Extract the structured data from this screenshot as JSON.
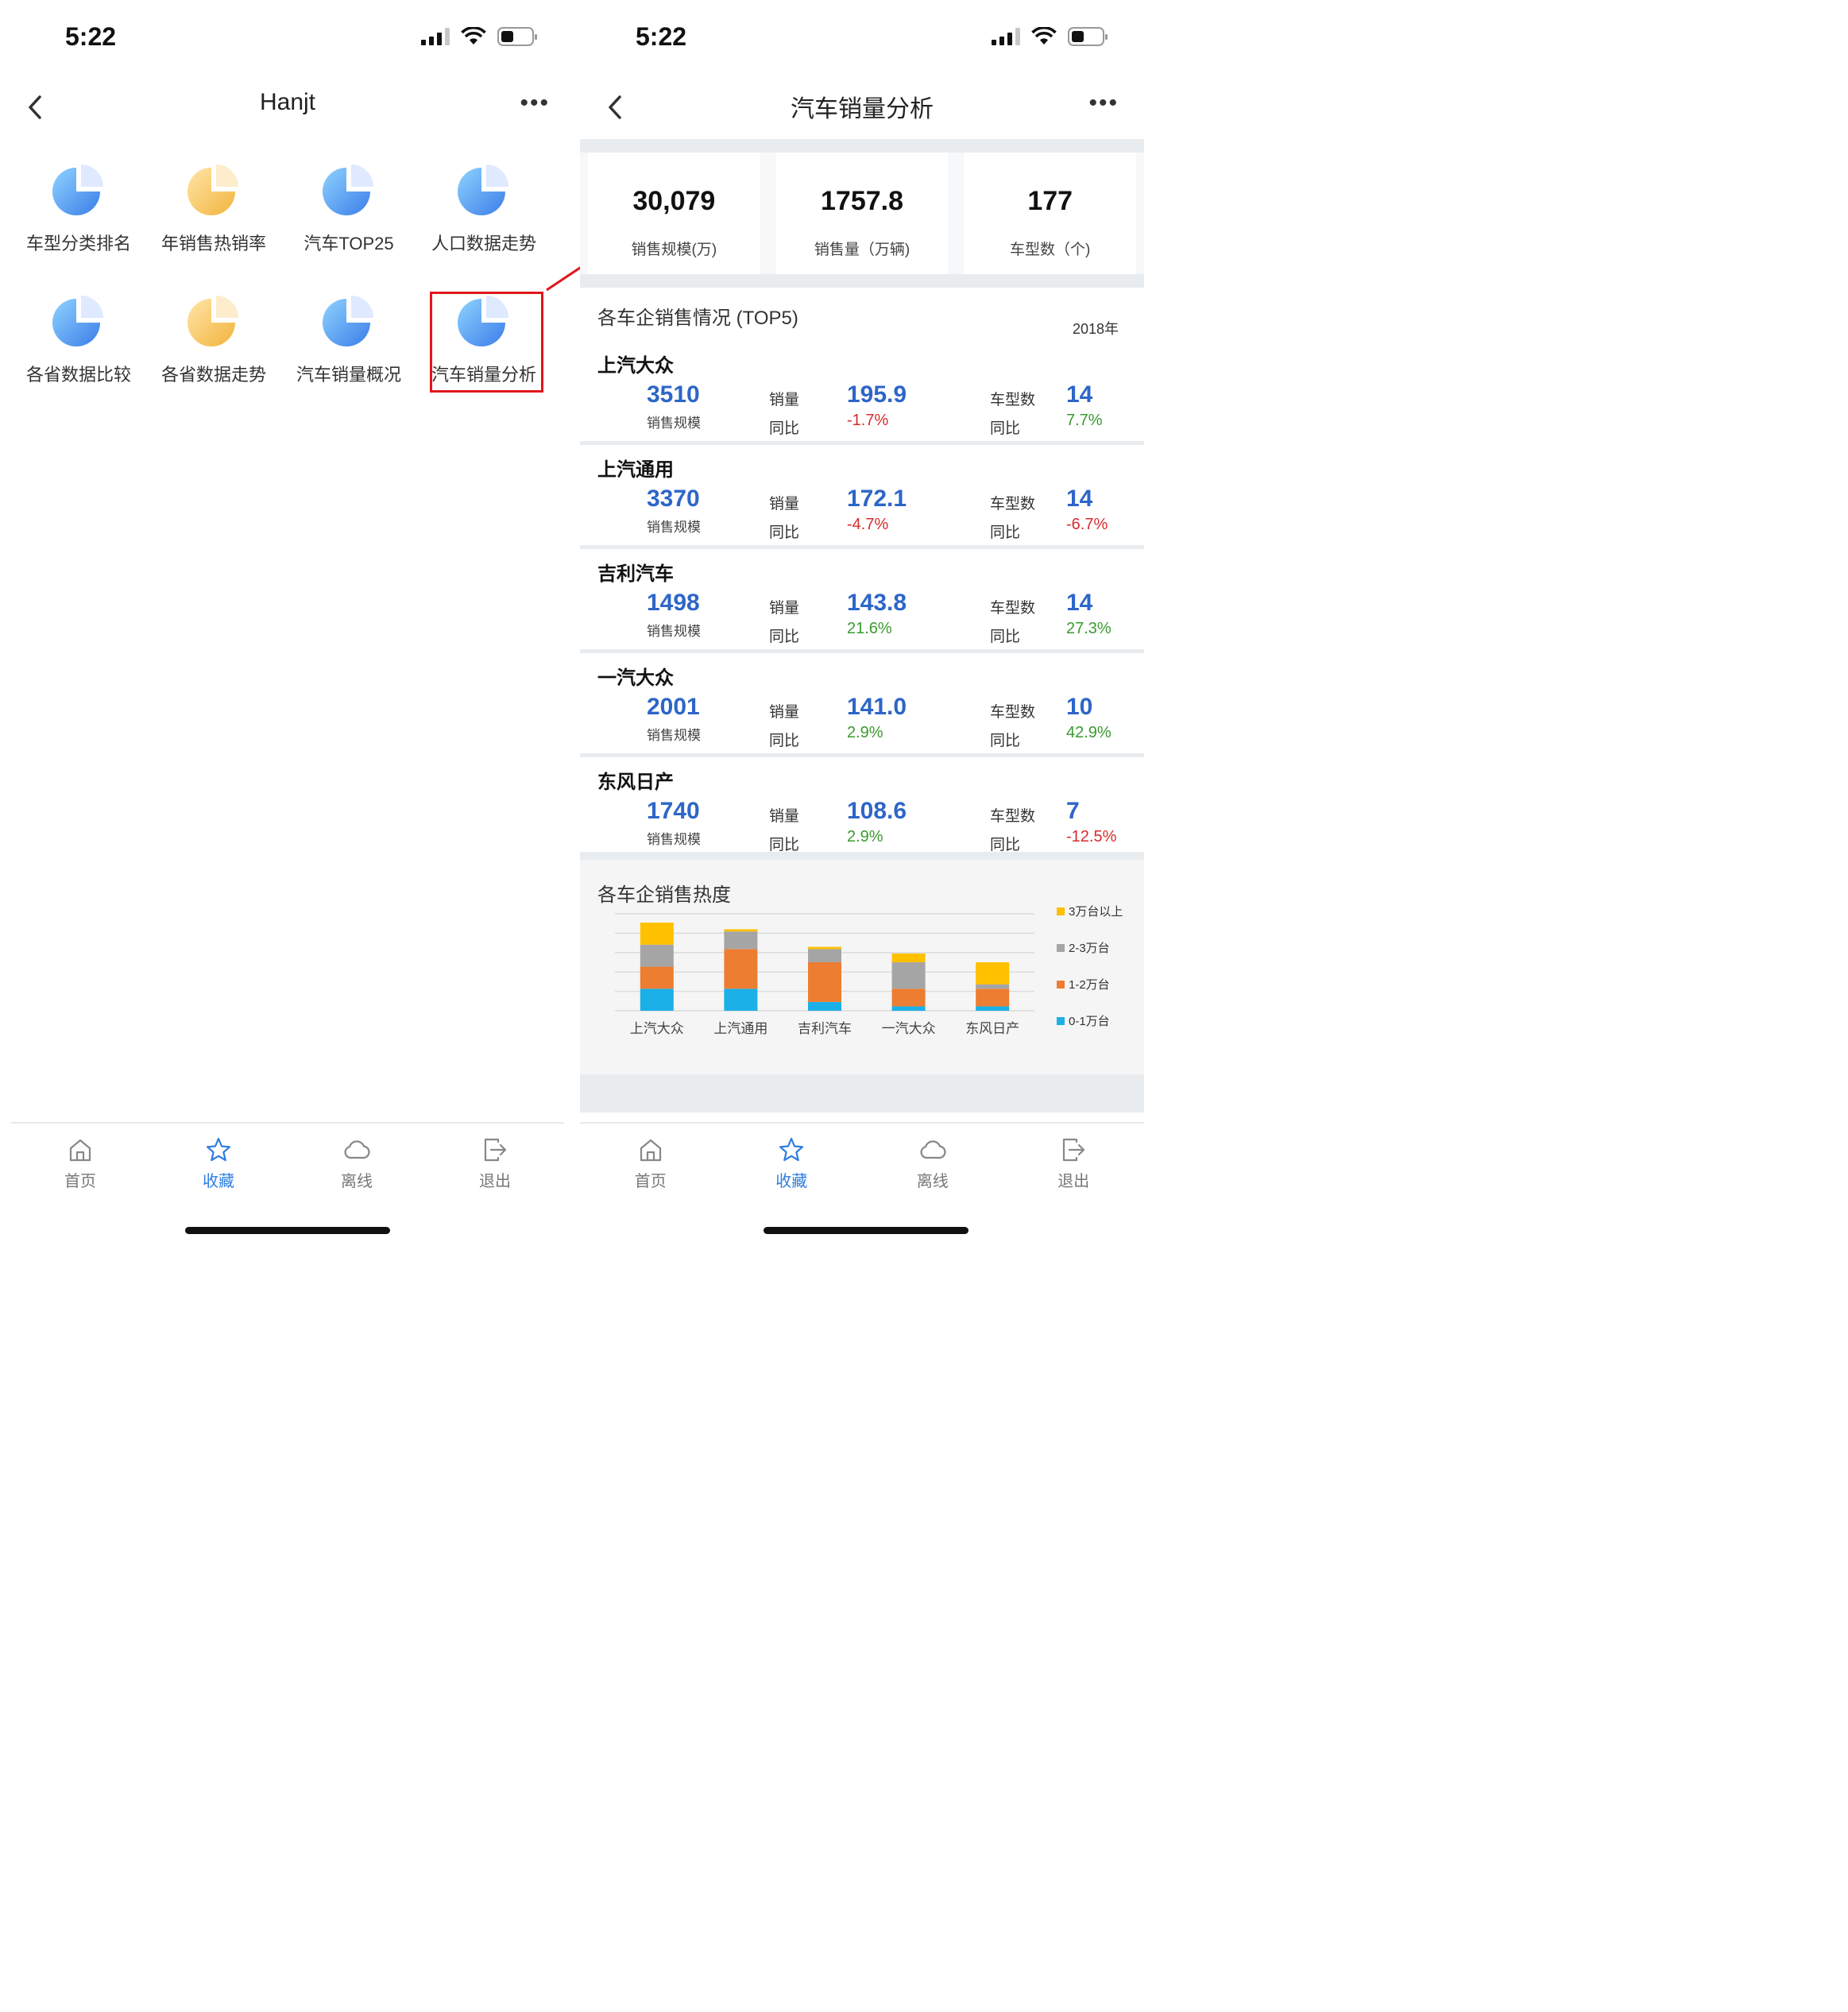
{
  "left": {
    "status_time": "5:22",
    "title": "Hanjt",
    "favorites": [
      {
        "label": "车型分类排名",
        "color": "blue"
      },
      {
        "label": "年销售热销率",
        "color": "orange"
      },
      {
        "label": "汽车TOP25",
        "color": "blue"
      },
      {
        "label": "人口数据走势",
        "color": "blue"
      },
      {
        "label": "各省数据比较",
        "color": "blue"
      },
      {
        "label": "各省数据走势",
        "color": "orange"
      },
      {
        "label": "汽车销量概况",
        "color": "blue"
      },
      {
        "label": "汽车销量分析",
        "color": "blue"
      }
    ]
  },
  "right": {
    "status_time": "5:22",
    "title": "汽车销量分析",
    "kpis": [
      {
        "value": "30,079",
        "label": "销售规模(万)"
      },
      {
        "value": "1757.8",
        "label": "销售量（万辆)"
      },
      {
        "value": "177",
        "label": "车型数（个)"
      }
    ],
    "top5_title": "各车企销售情况 (TOP5)",
    "year": "2018年",
    "labels": {
      "scale": "销售规模",
      "sales": "销量",
      "yoy": "同比",
      "models": "车型数"
    },
    "companies": [
      {
        "name": "上汽大众",
        "scale": "3510",
        "sales": "195.9",
        "sales_yoy": "-1.7%",
        "models": "14",
        "models_yoy": "7.7%"
      },
      {
        "name": "上汽通用",
        "scale": "3370",
        "sales": "172.1",
        "sales_yoy": "-4.7%",
        "models": "14",
        "models_yoy": "-6.7%"
      },
      {
        "name": "吉利汽车",
        "scale": "1498",
        "sales": "143.8",
        "sales_yoy": "21.6%",
        "models": "14",
        "models_yoy": "27.3%"
      },
      {
        "name": "一汽大众",
        "scale": "2001",
        "sales": "141.0",
        "sales_yoy": "2.9%",
        "models": "10",
        "models_yoy": "42.9%"
      },
      {
        "name": "东风日产",
        "scale": "1740",
        "sales": "108.6",
        "sales_yoy": "2.9%",
        "models": "7",
        "models_yoy": "-12.5%"
      }
    ],
    "heat_title": "各车企销售热度"
  },
  "tabs": [
    {
      "label": "首页",
      "icon": "home-icon",
      "active": false
    },
    {
      "label": "收藏",
      "icon": "star-icon",
      "active": true
    },
    {
      "label": "离线",
      "icon": "cloud-icon",
      "active": false
    },
    {
      "label": "退出",
      "icon": "logout-icon",
      "active": false
    }
  ],
  "colors": {
    "accent": "#2f7de0",
    "value_blue": "#2d66c8",
    "negative": "#d62c2c",
    "positive": "#3a9a2f",
    "highlight": "#e0161c"
  },
  "chart_data": {
    "type": "bar",
    "stacked": true,
    "categories": [
      "上汽大众",
      "上汽通用",
      "吉利汽车",
      "一汽大众",
      "东风日产"
    ],
    "series": [
      {
        "name": "0-1万台",
        "color": "#1bb0e8",
        "values": [
          5,
          5,
          2,
          1,
          1
        ]
      },
      {
        "name": "1-2万台",
        "color": "#ed7d31",
        "values": [
          5,
          9,
          9,
          4,
          4
        ]
      },
      {
        "name": "2-3万台",
        "color": "#a5a5a5",
        "values": [
          5,
          4,
          3,
          6,
          1
        ]
      },
      {
        "name": "3万台以上",
        "color": "#ffc000",
        "values": [
          5,
          0.5,
          0.5,
          2,
          5
        ]
      }
    ],
    "ylim": [
      0,
      22
    ],
    "grid": true,
    "legend": "right",
    "title": "各车企销售热度"
  }
}
